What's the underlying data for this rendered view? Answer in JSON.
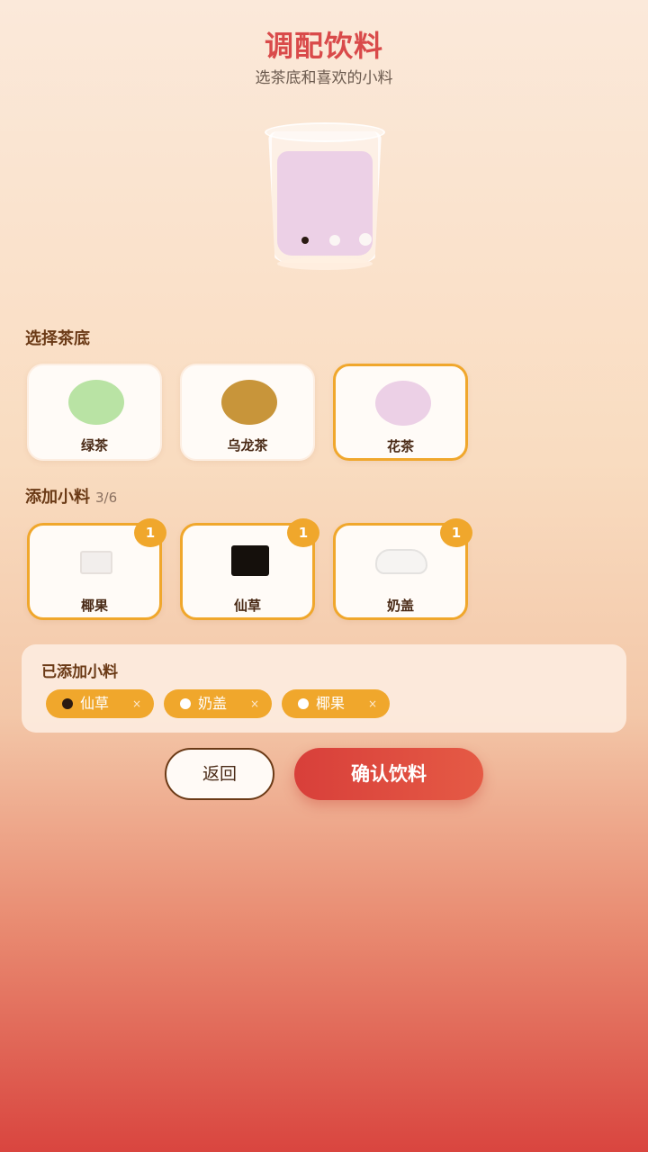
{
  "header": {
    "title": "调配饮料",
    "subtitle": "选茶底和喜欢的小料"
  },
  "tea_section": {
    "label": "选择茶底",
    "items": [
      {
        "label": "绿茶",
        "color": "#b9e3a4",
        "selected": false
      },
      {
        "label": "乌龙茶",
        "color": "#c8953a",
        "selected": false
      },
      {
        "label": "花茶",
        "color": "#ecd0e6",
        "selected": true
      }
    ]
  },
  "topping_section": {
    "label": "添加小料",
    "count": "3/6",
    "items": [
      {
        "label": "椰果",
        "badge": "1",
        "icon": "coconut-jelly-icon"
      },
      {
        "label": "仙草",
        "badge": "1",
        "icon": "grass-jelly-icon"
      },
      {
        "label": "奶盖",
        "badge": "1",
        "icon": "milk-foam-icon"
      }
    ]
  },
  "added": {
    "title": "已添加小料",
    "chips": [
      {
        "label": "仙草",
        "remove": "×",
        "dot_color": "#2a1a12"
      },
      {
        "label": "奶盖",
        "remove": "×",
        "dot_color": "#ffffff"
      },
      {
        "label": "椰果",
        "remove": "×",
        "dot_color": "#ffffff"
      }
    ]
  },
  "actions": {
    "back_label": "返回",
    "confirm_label": "确认饮料"
  },
  "colors": {
    "accent": "#f0a72c",
    "primary": "#d94a4a",
    "text": "#6b3a16"
  }
}
